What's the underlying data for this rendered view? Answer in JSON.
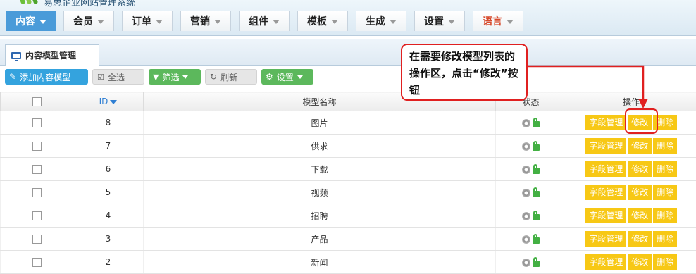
{
  "header": {
    "site_title": "易思企业网站管理系统",
    "nav": [
      {
        "label": "内容",
        "active": true
      },
      {
        "label": "会员"
      },
      {
        "label": "订单"
      },
      {
        "label": "营销"
      },
      {
        "label": "组件"
      },
      {
        "label": "模板"
      },
      {
        "label": "生成"
      },
      {
        "label": "设置"
      },
      {
        "label": "语言"
      }
    ]
  },
  "page_tab": {
    "label": "内容模型管理"
  },
  "toolbar": {
    "add_label": "添加内容模型",
    "select_all_label": "全选",
    "filter_label": "筛选",
    "refresh_label": "刷新",
    "settings_label": "设置"
  },
  "table": {
    "headers": {
      "id": "ID",
      "name": "模型名称",
      "status": "状态",
      "actions": "操作"
    },
    "action_labels": {
      "fields": "字段管理",
      "edit": "修改",
      "delete": "删除"
    },
    "rows": [
      {
        "id": "8",
        "name": "图片"
      },
      {
        "id": "7",
        "name": "供求"
      },
      {
        "id": "6",
        "name": "下载"
      },
      {
        "id": "5",
        "name": "视频"
      },
      {
        "id": "4",
        "name": "招聘"
      },
      {
        "id": "3",
        "name": "产品"
      },
      {
        "id": "2",
        "name": "新闻"
      }
    ]
  },
  "callout": {
    "text": "在需要修改模型列表的操作区，点击“修改”按钮"
  },
  "colors": {
    "accent_blue": "#34a3de",
    "action_yellow": "#f7c815",
    "annotation_red": "#e02020",
    "filter_green": "#5cb85c"
  }
}
